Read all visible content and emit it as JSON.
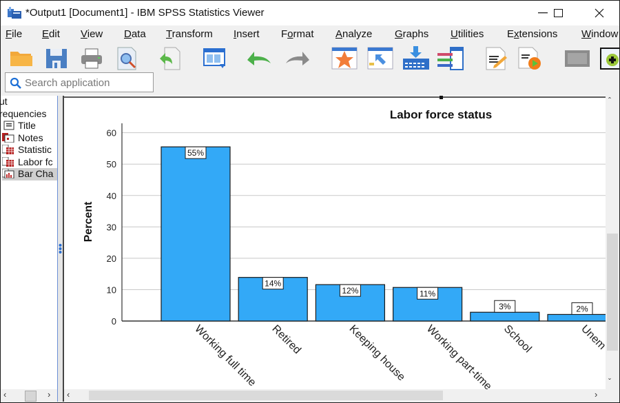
{
  "window": {
    "title": "*Output1 [Document1] - IBM SPSS Statistics Viewer",
    "controls": {
      "minimize": "—",
      "maximize": "☐",
      "close": "✕"
    }
  },
  "menu": [
    {
      "label": "File",
      "accel": "F",
      "rest": "ile"
    },
    {
      "label": "Edit",
      "accel": "E",
      "rest": "dit"
    },
    {
      "label": "View",
      "accel": "V",
      "rest": "iew"
    },
    {
      "label": "Data",
      "accel": "D",
      "rest": "ata"
    },
    {
      "label": "Transform",
      "accel": "T",
      "rest": "ransform"
    },
    {
      "label": "Insert",
      "accel": "I",
      "rest": "nsert"
    },
    {
      "label": "Format",
      "accel": "o",
      "rest": ""
    },
    {
      "label": "Analyze",
      "accel": "A",
      "rest": "nalyze"
    },
    {
      "label": "Graphs",
      "accel": "G",
      "rest": "raphs"
    },
    {
      "label": "Utilities",
      "accel": "U",
      "rest": "tilities"
    },
    {
      "label": "Extensions",
      "accel": "x",
      "rest": ""
    },
    {
      "label": "Window",
      "accel": "W",
      "rest": "indow"
    }
  ],
  "toolbar": [
    {
      "name": "open-icon"
    },
    {
      "name": "save-icon"
    },
    {
      "name": "print-icon"
    },
    {
      "name": "print-preview-icon"
    },
    {
      "name": "export-icon"
    },
    {
      "name": "recall-dialog-icon"
    },
    {
      "name": "undo-icon"
    },
    {
      "name": "redo-icon"
    },
    {
      "name": "goto-case-icon"
    },
    {
      "name": "goto-variable-icon"
    },
    {
      "name": "insert-cases-icon"
    },
    {
      "name": "split-file-icon"
    },
    {
      "name": "edit-script-icon"
    },
    {
      "name": "run-script-icon"
    },
    {
      "name": "hide-icon"
    },
    {
      "name": "designate-window-icon"
    }
  ],
  "search": {
    "placeholder": "Search application"
  },
  "outline": {
    "items": [
      {
        "label": "ut",
        "type": "root"
      },
      {
        "label": "requencies",
        "type": "folder"
      },
      {
        "label": "Title",
        "type": "title"
      },
      {
        "label": "Notes",
        "type": "notes"
      },
      {
        "label": "Statistic",
        "type": "table"
      },
      {
        "label": "Labor fc",
        "type": "table"
      },
      {
        "label": "Bar Cha",
        "type": "chart",
        "selected": true
      }
    ]
  },
  "chart_data": {
    "type": "bar",
    "title": "Labor force status",
    "xlabel": "",
    "ylabel": "Percent",
    "ylim": [
      0,
      63
    ],
    "yticks": [
      0,
      10,
      20,
      30,
      40,
      50,
      60
    ],
    "grid": true,
    "bar_color": "#33a9f7",
    "categories": [
      "Working full time",
      "Retired",
      "Keeping house",
      "Working part-time",
      "School",
      "Unem"
    ],
    "values": [
      55.5,
      13.9,
      11.6,
      10.7,
      2.8,
      2.1
    ],
    "data_labels": [
      "55%",
      "14%",
      "12%",
      "11%",
      "3%",
      "2%"
    ]
  }
}
